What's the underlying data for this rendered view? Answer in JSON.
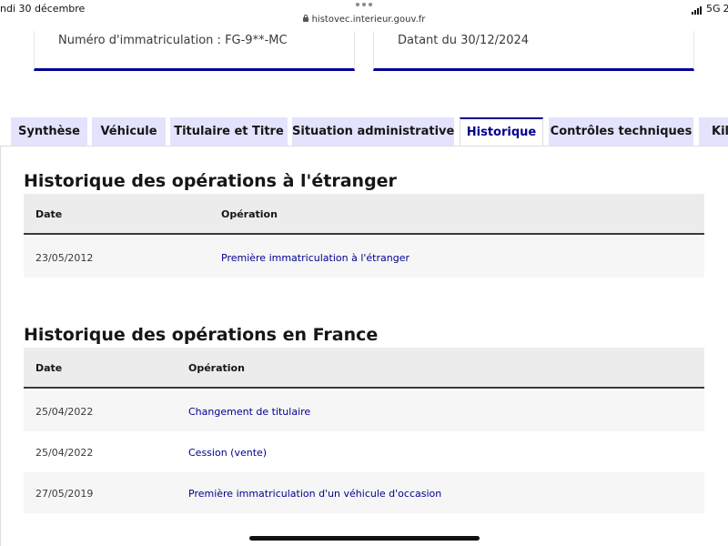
{
  "status_bar": {
    "time": "ndi 30 décembre",
    "url": "histovec.interieur.gouv.fr",
    "network": "5G",
    "battery": "2"
  },
  "summary": {
    "plate": "Numéro d'immatriculation : FG-9**-MC",
    "date": "Datant du 30/12/2024"
  },
  "tabs": [
    {
      "label": "Synthèse"
    },
    {
      "label": "Véhicule"
    },
    {
      "label": "Titulaire et Titre"
    },
    {
      "label": "Situation administrative"
    },
    {
      "label": "Historique",
      "active": true
    },
    {
      "label": "Contrôles techniques"
    },
    {
      "label": "Kilo"
    }
  ],
  "foreign": {
    "title": "Historique des opérations à l'étranger",
    "headers": {
      "date": "Date",
      "operation": "Opération"
    },
    "rows": [
      {
        "date": "23/05/2012",
        "operation": "Première immatriculation à l'étranger"
      }
    ]
  },
  "france": {
    "title": "Historique des opérations en France",
    "headers": {
      "date": "Date",
      "operation": "Opération"
    },
    "rows": [
      {
        "date": "25/04/2022",
        "operation": "Changement de titulaire"
      },
      {
        "date": "25/04/2022",
        "operation": "Cession (vente)"
      },
      {
        "date": "27/05/2019",
        "operation": "Première immatriculation d'un véhicule d'occasion"
      }
    ]
  },
  "colors": {
    "accent": "#000091",
    "tab_bg": "#e3e3fd"
  }
}
